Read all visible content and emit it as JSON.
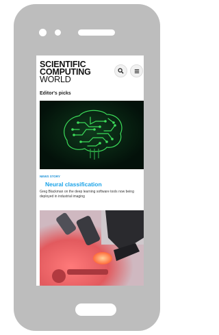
{
  "site": {
    "logo_line1": "SCIENTIFIC",
    "logo_line2": "COMPUTING",
    "logo_line3": "WORLD"
  },
  "section": {
    "title": "Editor's picks"
  },
  "article": {
    "kicker": "NEWS STORY",
    "headline": "Neural classification",
    "summary": "Greg Blackman on the deep learning software tools now being deployed in industrial imaging"
  },
  "icons": {
    "search": "search-icon",
    "menu": "menu-icon"
  },
  "colors": {
    "accent": "#1aa3e8",
    "phone": "#bdbdbd",
    "hero_bg": "#04140a",
    "circuit": "#3ddc5a"
  }
}
